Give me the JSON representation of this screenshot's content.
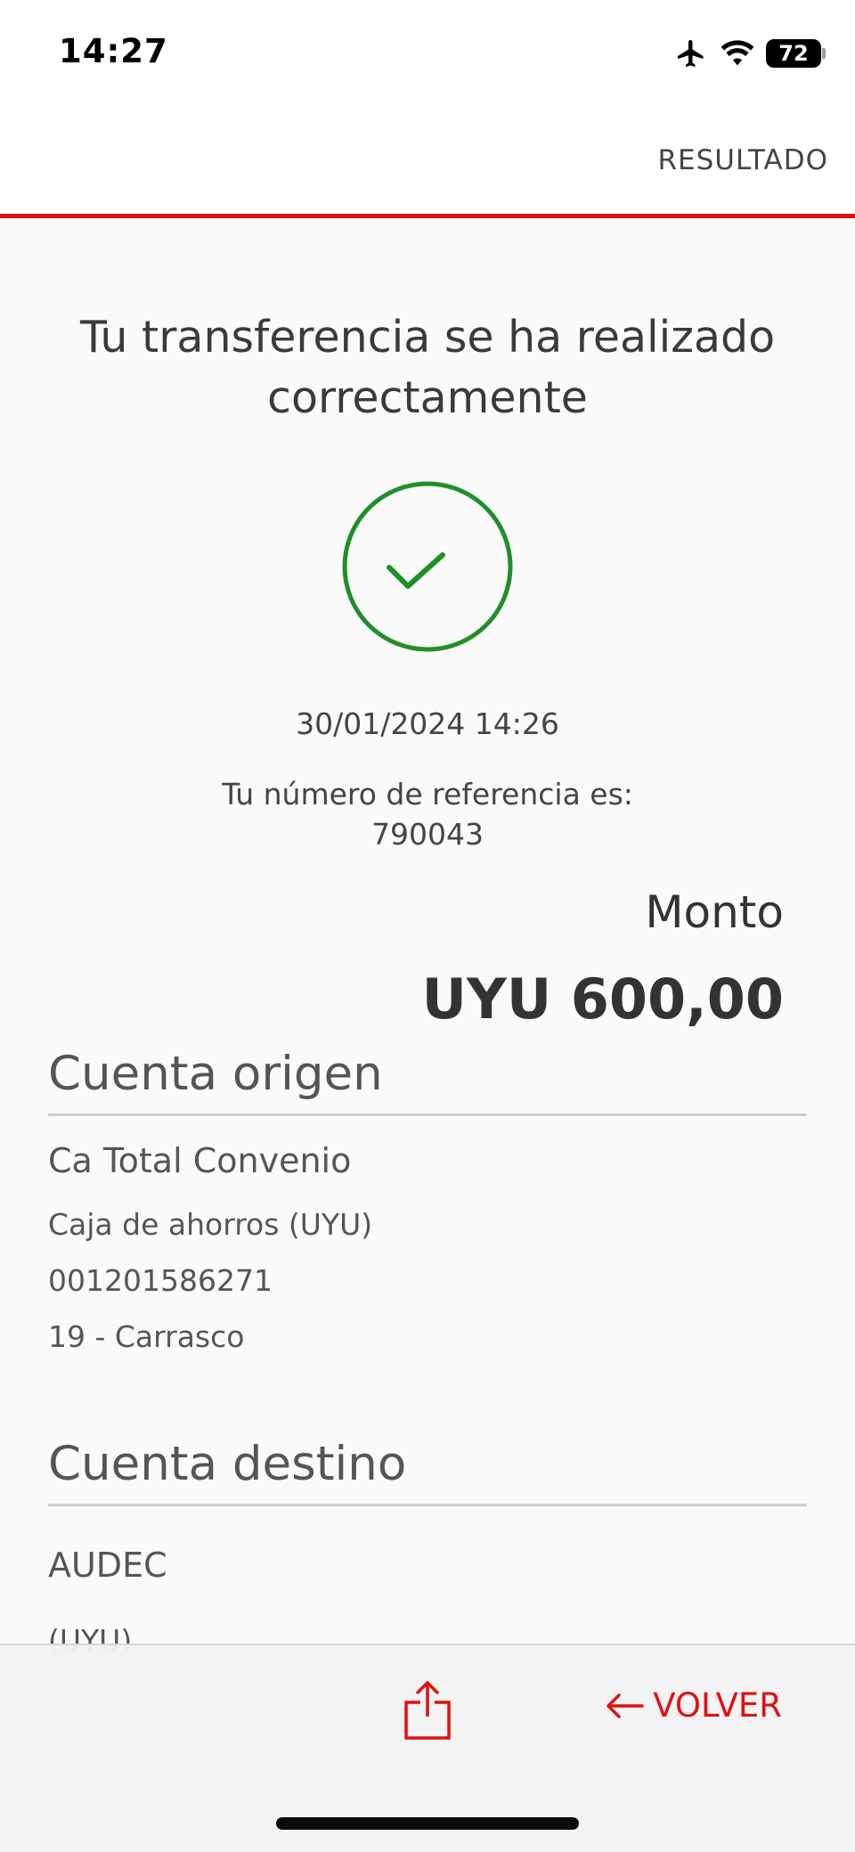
{
  "status": {
    "time": "14:27",
    "battery": "72"
  },
  "header": {
    "title": "RESULTADO"
  },
  "result": {
    "title": "Tu transferencia se ha realizado correctamente",
    "datetime": "30/01/2024 14:26",
    "reference_label": "Tu número de referencia es:",
    "reference_number": "790043"
  },
  "amount": {
    "label": "Monto",
    "value": "UYU 600,00"
  },
  "origin": {
    "title": "Cuenta origen",
    "name": "Ca Total Convenio",
    "type": "Caja de ahorros (UYU)",
    "number": "001201586271",
    "branch": "19 - Carrasco"
  },
  "destination": {
    "title": "Cuenta destino",
    "name": "AUDEC",
    "currency": "(UYU)"
  },
  "actions": {
    "volver_label": "VOLVER"
  },
  "colors": {
    "accent": "#e01010",
    "success": "#1f8f2a"
  },
  "icons": [
    "airplane-icon",
    "wifi-icon",
    "battery-icon",
    "check-circle-icon",
    "share-icon",
    "arrow-left-icon"
  ]
}
